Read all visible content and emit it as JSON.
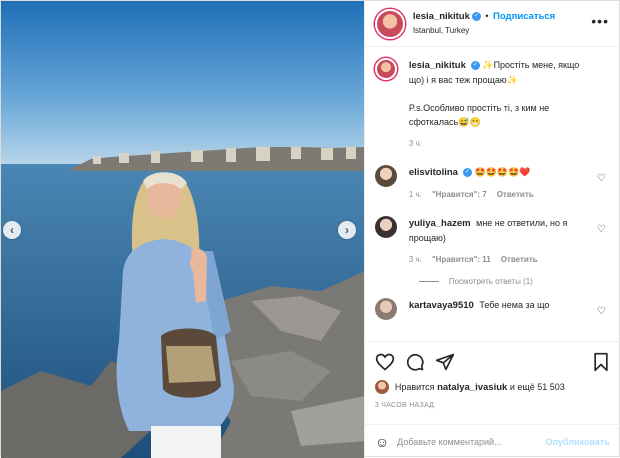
{
  "header": {
    "username": "lesia_nikituk",
    "separator": "•",
    "follow_label": "Подписаться",
    "location": "Istanbul, Turkey",
    "more_icon": "more-horizontal-icon"
  },
  "caption": {
    "username": "lesia_nikituk",
    "text_line1": "✨Простіть мене, якщо що) і я вас теж прощаю✨",
    "text_line2": "P.s.Особливо простіть ті, з ким не сфоткалась😅😁",
    "time": "3 ч."
  },
  "comments": [
    {
      "username": "elisvitolina",
      "text": "🤩🤩🤩🤩❤️",
      "time": "1 ч.",
      "likes": "\"Нравится\": 7",
      "reply_label": "Ответить"
    },
    {
      "username": "yuliya_hazem",
      "text": "мне не ответили, но я прощаю)",
      "time": "3 ч.",
      "likes": "\"Нравится\": 11",
      "reply_label": "Ответить",
      "view_replies": "Посмотреть ответы (1)"
    },
    {
      "username": "kartavaya9510",
      "text": "Тебе нема за що"
    }
  ],
  "likes": {
    "prefix": "Нравится",
    "user": "natalya_ivasiuk",
    "suffix": "и ещё 51 503"
  },
  "time_ago": "3 ЧАСОВ НАЗАД",
  "add_comment": {
    "placeholder": "Добавьте комментарий...",
    "publish_label": "Опубликовать"
  },
  "colors": {
    "accent": "#0095f6",
    "verified": "#3897f0",
    "muted": "#8e8e8e"
  }
}
